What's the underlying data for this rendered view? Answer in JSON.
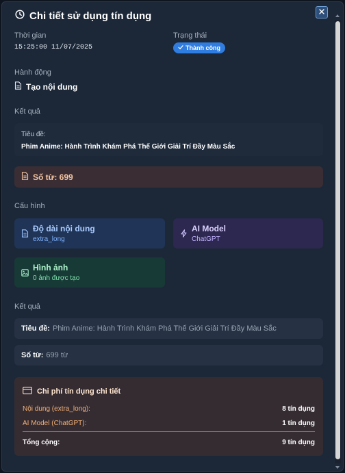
{
  "modal": {
    "title": "Chi tiết sử dụng tín dụng"
  },
  "info": {
    "time_label": "Thời gian",
    "time_value": "15:25:00 11/07/2025",
    "status_label": "Trạng thái",
    "status_value": "Thành công",
    "action_label": "Hành động",
    "action_value": "Tạo nội dung"
  },
  "result_section": {
    "heading": "Kết quả",
    "title_label": "Tiêu đề:",
    "title_value": "Phim Anime: Hành Trình Khám Phá Thế Giới Giải Trí Đầy Màu Sắc",
    "word_count": "Số từ: 699"
  },
  "config": {
    "heading": "Cấu hình",
    "cards": [
      {
        "title": "Độ dài nội dung",
        "subtitle": "extra_long",
        "icon": "document-icon"
      },
      {
        "title": "AI Model",
        "subtitle": "ChatGPT",
        "icon": "lightning-icon"
      },
      {
        "title": "Hình ảnh",
        "subtitle": "0 ảnh được tạo",
        "icon": "image-icon"
      }
    ]
  },
  "result_summary": {
    "heading": "Kết quả",
    "title_label": "Tiêu đề:",
    "title_value": "Phim Anime: Hành Trình Khám Phá Thế Giới Giải Trí Đầy Màu Sắc",
    "words_label": "Số từ:",
    "words_value": "699 từ"
  },
  "cost": {
    "heading": "Chi phí tín dụng chi tiết",
    "lines": [
      {
        "label": "Nội dung (extra_long):",
        "value": "8 tín dụng"
      },
      {
        "label": "AI Model (ChatGPT):",
        "value": "1 tín dụng"
      }
    ],
    "total_label": "Tổng cộng:",
    "total_value": "9 tín dụng"
  },
  "colors": {
    "accent": "#2f7de0",
    "success_badge": "#2f7de0",
    "card_blue": "#1f3456",
    "card_purple": "#2c2850",
    "card_green": "#183a36",
    "cost_panel": "#352c32"
  }
}
